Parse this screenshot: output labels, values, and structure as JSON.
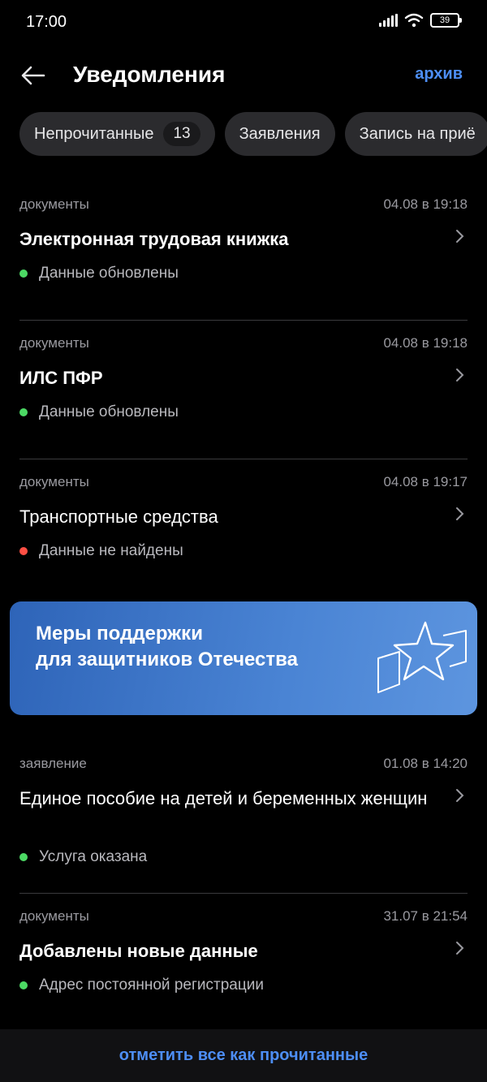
{
  "status_bar": {
    "time": "17:00",
    "battery": "39"
  },
  "header": {
    "title": "Уведомления",
    "archive": "архив"
  },
  "chips": [
    {
      "label": "Непрочитанные",
      "count": "13"
    },
    {
      "label": "Заявления"
    },
    {
      "label": "Запись на приё"
    }
  ],
  "notifications": [
    {
      "category": "документы",
      "date": "04.08 в 19:18",
      "title": "Электронная трудовая книжка",
      "status": "Данные обновлены",
      "status_color": "#4cd964"
    },
    {
      "category": "документы",
      "date": "04.08 в 19:18",
      "title": "ИЛС ПФР",
      "status": "Данные обновлены",
      "status_color": "#4cd964"
    },
    {
      "category": "документы",
      "date": "04.08 в 19:17",
      "title": "Транспортные средства",
      "status": "Данные не найдены",
      "status_color": "#ff4f44"
    }
  ],
  "banner": {
    "line1": "Меры поддержки",
    "line2": "для защитников Отечества"
  },
  "notifications2": [
    {
      "category": "заявление",
      "date": "01.08 в 14:20",
      "title": "Единое пособие на детей и беременных женщин",
      "status": "Услуга оказана",
      "status_color": "#4cd964"
    },
    {
      "category": "документы",
      "date": "31.07 в 21:54",
      "title": "Добавлены новые данные",
      "status": "Адрес постоянной регистрации",
      "status_color": "#4cd964"
    }
  ],
  "bottom": {
    "mark_all": "отметить все как прочитанные"
  },
  "colors": {
    "accent": "#4d8ef5",
    "success": "#4cd964",
    "error": "#ff4f44"
  }
}
